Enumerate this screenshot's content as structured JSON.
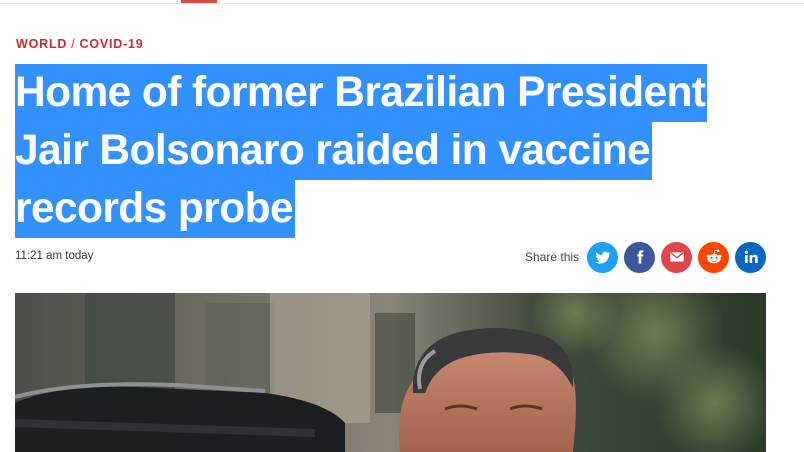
{
  "breadcrumb": {
    "section": "WORLD",
    "subsection": "COVID-19"
  },
  "article": {
    "headline_lines": [
      "Home of former Brazilian President",
      "Jair Bolsonaro raided in vaccine",
      "records probe"
    ],
    "timestamp": "11:21 am today"
  },
  "share": {
    "label": "Share this",
    "buttons": [
      "twitter-icon",
      "facebook-icon",
      "email-icon",
      "reddit-icon",
      "linkedin-icon"
    ]
  },
  "colors": {
    "accent": "#c4302b",
    "selection": "#3390ff",
    "twitter": "#1da1f2",
    "facebook": "#3b5998",
    "email": "#e0454e",
    "reddit": "#ff4500",
    "linkedin": "#0a66c2"
  }
}
